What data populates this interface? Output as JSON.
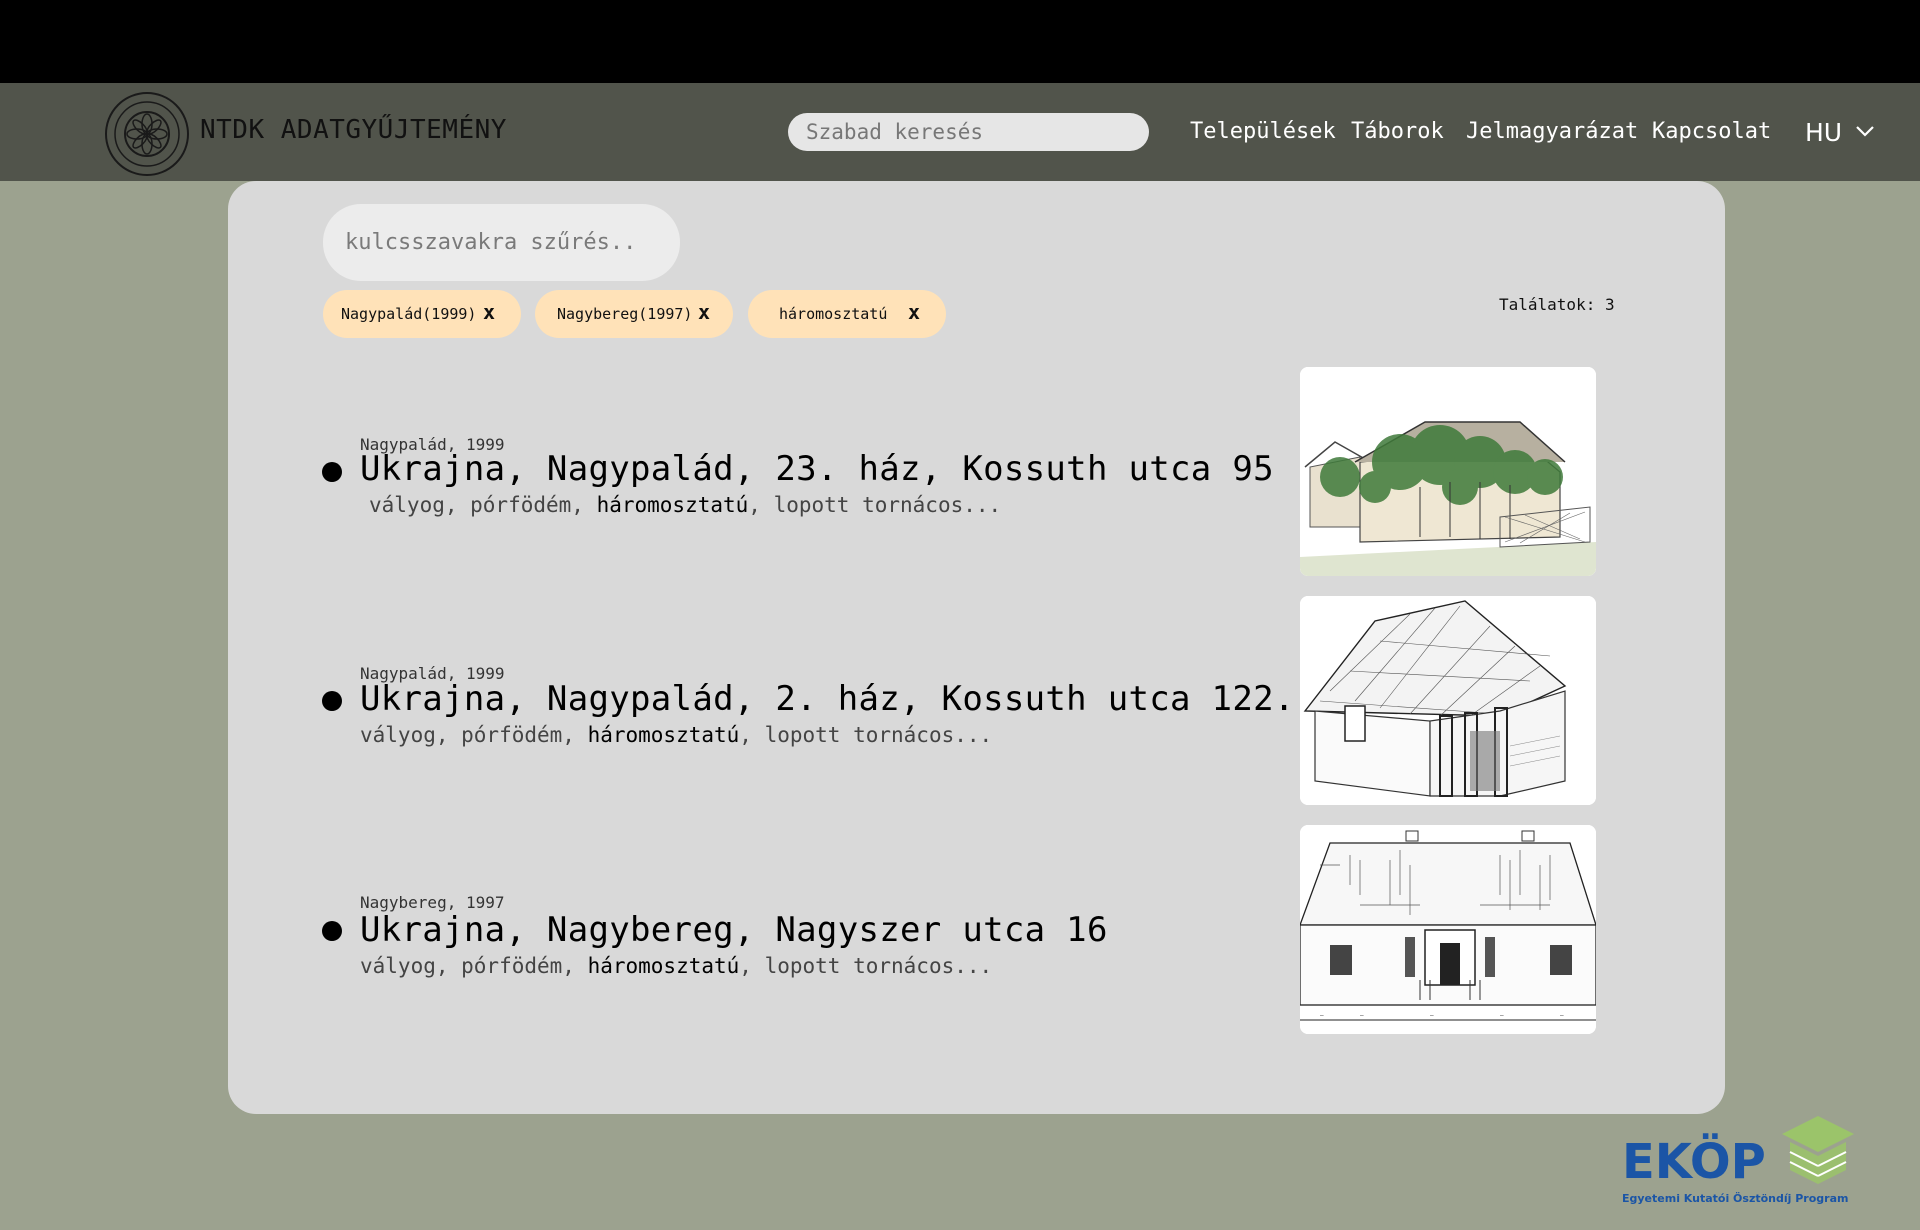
{
  "brand": {
    "title": "NTDK ADATGYŰJTEMÉNY"
  },
  "nav": {
    "search_placeholder": "Szabad keresés",
    "links": [
      "Települések",
      "Táborok",
      "Jelmagyarázat",
      "Kapcsolat"
    ],
    "language": "HU"
  },
  "filter": {
    "placeholder": "kulcsszavakra szűrés..",
    "chips": [
      {
        "label": "Nagypalád(1999)",
        "remove": "x"
      },
      {
        "label": "Nagybereg(1997)",
        "remove": "x"
      },
      {
        "label": "háromosztatú",
        "remove": "x"
      }
    ],
    "results_label": "Találatok:",
    "results_count": "3"
  },
  "results": [
    {
      "meta": "Nagypalád, 1999",
      "title": "Ukrajna, Nagypalád, 23. ház, Kossuth utca 95",
      "tag1": "vályog, pórfödém, ",
      "tag_highlight": "háromosztatú",
      "tag2": ", lopott tornácos..."
    },
    {
      "meta": "Nagypalád, 1999",
      "title": "Ukrajna, Nagypalád, 2. ház, Kossuth utca 122.",
      "tag1": "vályog, pórfödém, ",
      "tag_highlight": "háromosztatú",
      "tag2": ", lopott tornácos..."
    },
    {
      "meta": "Nagybereg, 1997",
      "title": "Ukrajna, Nagybereg, Nagyszer utca 16",
      "tag1": "vályog, pórfödém, ",
      "tag_highlight": "háromosztatú",
      "tag2": ", lopott tornácos..."
    }
  ],
  "footer_logo": {
    "name": "EKÖP",
    "subtitle": "Egyetemi Kutatói Ösztöndíj Program"
  },
  "seal_text": "ÉPÍTÉSZETI TUDOMÁNYOS DIÁKKÖR · ÓE-YBL",
  "colors": {
    "accent_chip": "#ffe2b8",
    "navbar": "#51544b",
    "background": "#9ca28f",
    "ekop_blue": "#1b55a6",
    "ekop_green": "#9bc46a"
  }
}
